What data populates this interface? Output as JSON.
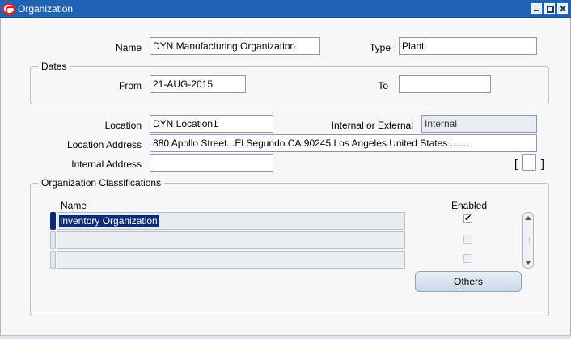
{
  "window": {
    "title": "Organization"
  },
  "form": {
    "name_label": "Name",
    "name_value": "DYN Manufacturing Organization",
    "type_label": "Type",
    "type_value": "Plant",
    "dates_group": "Dates",
    "from_label": "From",
    "from_value": "21-AUG-2015",
    "to_label": "To",
    "to_value": "",
    "location_label": "Location",
    "location_value": "DYN Location1",
    "internal_external_label": "Internal or External",
    "internal_external_value": "Internal",
    "location_address_label": "Location Address",
    "location_address_value": "880 Apollo Street...El Segundo.CA.90245.Los Angeles.United States........",
    "internal_address_label": "Internal Address",
    "internal_address_value": "",
    "bracket_left": "[",
    "bracket_right": "]"
  },
  "classifications": {
    "group_title": "Organization Classifications",
    "col_name": "Name",
    "col_enabled": "Enabled",
    "rows": [
      {
        "name": "Inventory Organization",
        "enabled": true
      },
      {
        "name": "",
        "enabled": false
      },
      {
        "name": "",
        "enabled": false
      }
    ],
    "others_button": "Others",
    "others_first": "O",
    "others_rest": "thers"
  }
}
